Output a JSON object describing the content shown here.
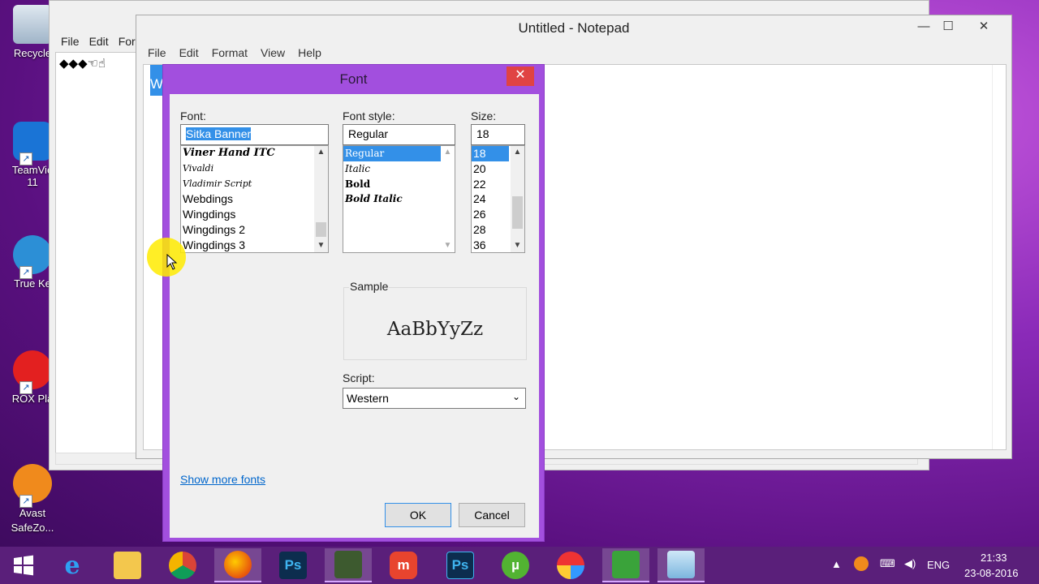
{
  "desktop": {
    "icons": [
      {
        "label": "Recycle",
        "icon": "recycle-bin-icon"
      },
      {
        "label": "TeamVie\n11",
        "icon": "teamviewer-icon"
      },
      {
        "label": "True Ke",
        "icon": "true-key-icon"
      },
      {
        "label": "ROX Pla",
        "icon": "rox-player-icon"
      },
      {
        "label": "Avast\nSafeZo...",
        "icon": "avast-safezone-icon"
      }
    ]
  },
  "back_window": {
    "title": "Untitled - Notepad",
    "menu": [
      "File",
      "Edit",
      "For"
    ],
    "content": "◆◆◆☜☝"
  },
  "notepad": {
    "title": "Untitled - Notepad",
    "menu": [
      "File",
      "Edit",
      "Format",
      "View",
      "Help"
    ],
    "selected_text": "W",
    "controls": {
      "minimize": "—",
      "maximize": "☐",
      "close": "✕"
    }
  },
  "font_dialog": {
    "title": "Font",
    "close": "✕",
    "font_label": "Font:",
    "font_value": "Sitka Banner",
    "font_list": [
      "Viner Hand ITC",
      "Vivaldi",
      "Vladimir Script",
      "Webdings",
      "Wingdings",
      "Wingdings 2",
      "Wingdings 3"
    ],
    "style_label": "Font style:",
    "style_value": "Regular",
    "style_list": [
      "Regular",
      "Italic",
      "Bold",
      "Bold Italic"
    ],
    "style_selected": "Regular",
    "size_label": "Size:",
    "size_value": "18",
    "size_list": [
      "18",
      "20",
      "22",
      "24",
      "26",
      "28",
      "36"
    ],
    "size_selected": "18",
    "sample_label": "Sample",
    "sample_text": "AaBbYyZz",
    "script_label": "Script:",
    "script_value": "Western",
    "show_more": "Show more fonts",
    "ok": "OK",
    "cancel": "Cancel"
  },
  "taskbar": {
    "apps": [
      "start-icon",
      "internet-explorer-icon",
      "file-explorer-icon",
      "chrome-icon",
      "firefox-icon",
      "photoshop-icon",
      "camtasia-icon",
      "meitu-icon",
      "photoshop-icon",
      "utorrent-icon",
      "apps-icon",
      "camtasia-recorder-icon",
      "notepad-icon"
    ],
    "ps_label": "Ps",
    "language": "ENG",
    "time": "21:33",
    "date": "23-08-2016"
  },
  "colors": {
    "dialog_frame": "#a24fde",
    "selection": "#3390e8",
    "taskbar": "#5a1f7a"
  }
}
